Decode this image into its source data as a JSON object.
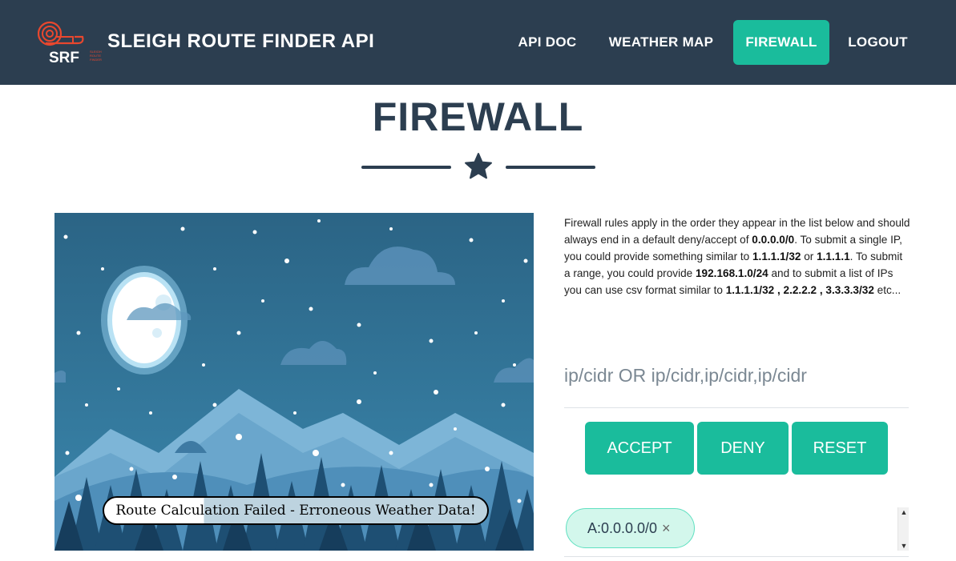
{
  "header": {
    "logo_text": "SRF",
    "title": "SLEIGH ROUTE FINDER API",
    "nav": {
      "api_doc": "API DOC",
      "weather_map": "WEATHER MAP",
      "firewall": "FIREWALL",
      "logout": "LOGOUT"
    },
    "active_nav": "firewall"
  },
  "page": {
    "title": "FIREWALL",
    "divider_icon": "star-icon"
  },
  "scene": {
    "banner": "Route Calculation Failed - Erroneous Weather Data!"
  },
  "help": {
    "p1": "Firewall rules apply in the order they appear in the list below and should always end in a default deny/accept of ",
    "b1": "0.0.0.0/0",
    "p2": ". To submit a single IP, you could provide something similar to ",
    "b2": "1.1.1.1/32",
    "p3": " or ",
    "b3": "1.1.1.1",
    "p4": ". To submit a range, you could provide ",
    "b4": "192.168.1.0/24",
    "p5": " and to submit a list of IPs you can use csv format similar to ",
    "b5": "1.1.1.1/32 , 2.2.2.2 , 3.3.3.3/32",
    "p6": " etc..."
  },
  "form": {
    "placeholder": "ip/cidr OR ip/cidr,ip/cidr,ip/cidr",
    "value": "",
    "accept": "ACCEPT",
    "deny": "DENY",
    "reset": "RESET"
  },
  "rules": [
    {
      "label": "A:0.0.0.0/0",
      "remove": "×"
    }
  ],
  "scrollbar": {
    "up": "▲",
    "down": "▼"
  },
  "colors": {
    "navbar": "#2c3e50",
    "accent": "#1abc9c",
    "chip_bg": "#d3f7ec",
    "chip_border": "#5fe0c0",
    "logo": "#e8472e"
  }
}
